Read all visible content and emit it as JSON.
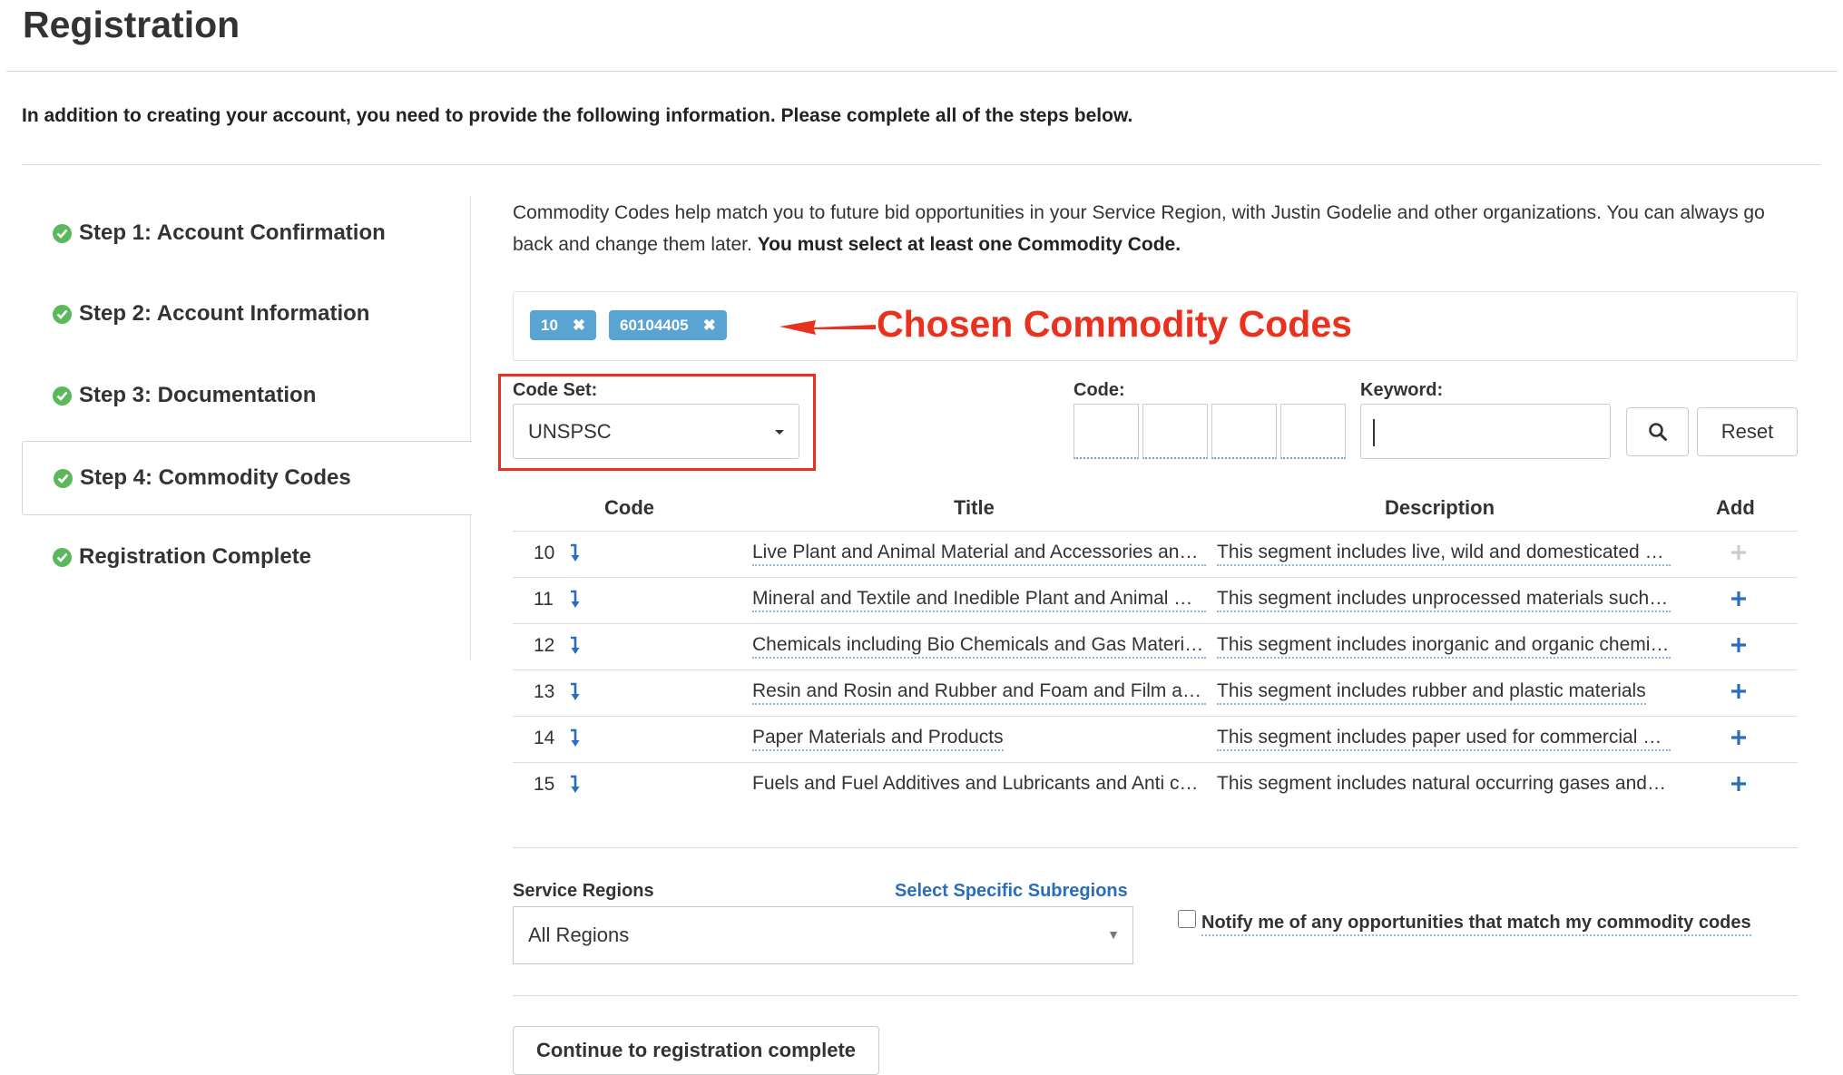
{
  "page": {
    "title": "Registration",
    "intro": "In addition to creating your account, you need to provide the following information. Please complete all of the steps below."
  },
  "steps": [
    {
      "label": "Step 1: Account Confirmation",
      "done": true
    },
    {
      "label": "Step 2: Account Information",
      "done": true
    },
    {
      "label": "Step 3: Documentation",
      "done": true
    },
    {
      "label": "Step 4: Commodity Codes",
      "done": true,
      "active": true
    },
    {
      "label": "Registration Complete",
      "done": true
    }
  ],
  "commodity": {
    "description_part1": "Commodity Codes help match you to future bid opportunities in your Service Region, with Justin Godelie and other organizations. You can always go back and change them later.",
    "description_bold": "You must select at least one Commodity Code.",
    "chosen_tags": [
      {
        "label": "10",
        "remove_icon": "close-icon"
      },
      {
        "label": "60104405",
        "remove_icon": "close-icon"
      }
    ],
    "callout": "Chosen Commodity Codes",
    "code_set_label": "Code Set:",
    "code_set_value": "UNSPSC",
    "code_label": "Code:",
    "keyword_label": "Keyword:",
    "keyword_value": "",
    "search_icon": "search-icon",
    "reset_label": "Reset"
  },
  "table": {
    "headers": {
      "code": "Code",
      "title": "Title",
      "description": "Description",
      "add": "Add"
    },
    "rows": [
      {
        "code": "10",
        "title": "Live Plant and Animal Material and Accessories and Supplies",
        "description": "This segment includes live, wild and domesticated plants and animals",
        "added": true
      },
      {
        "code": "11",
        "title": "Mineral and Textile and Inedible Plant and Animal Materials",
        "description": "This segment includes unprocessed materials such as minerals and textiles",
        "added": false
      },
      {
        "code": "12",
        "title": "Chemicals including Bio Chemicals and Gas Materials",
        "description": "This segment includes inorganic and organic chemicals",
        "added": false
      },
      {
        "code": "13",
        "title": "Resin and Rosin and Rubber and Foam and Film and Elastomeric Materials",
        "description": "This segment includes rubber and plastic materials",
        "added": false
      },
      {
        "code": "14",
        "title": "Paper Materials and Products",
        "description": "This segment includes paper used for commercial purposes",
        "added": false
      },
      {
        "code": "15",
        "title": "Fuels and Fuel Additives and Lubricants and Anti corrosive Materials",
        "description": "This segment includes natural occurring gases and fuels",
        "added": false
      }
    ]
  },
  "service_regions": {
    "label": "Service Regions",
    "subregions_link": "Select Specific Subregions",
    "value": "All Regions",
    "notify_label": "Notify me of any opportunities that match my commodity codes",
    "notify_checked": false
  },
  "actions": {
    "continue_label": "Continue to registration complete"
  },
  "colors": {
    "accent_blue": "#2a6ebb",
    "tag_blue": "#5aa4d4",
    "success_green": "#5cb85c",
    "annotation_red": "#e8321f"
  }
}
